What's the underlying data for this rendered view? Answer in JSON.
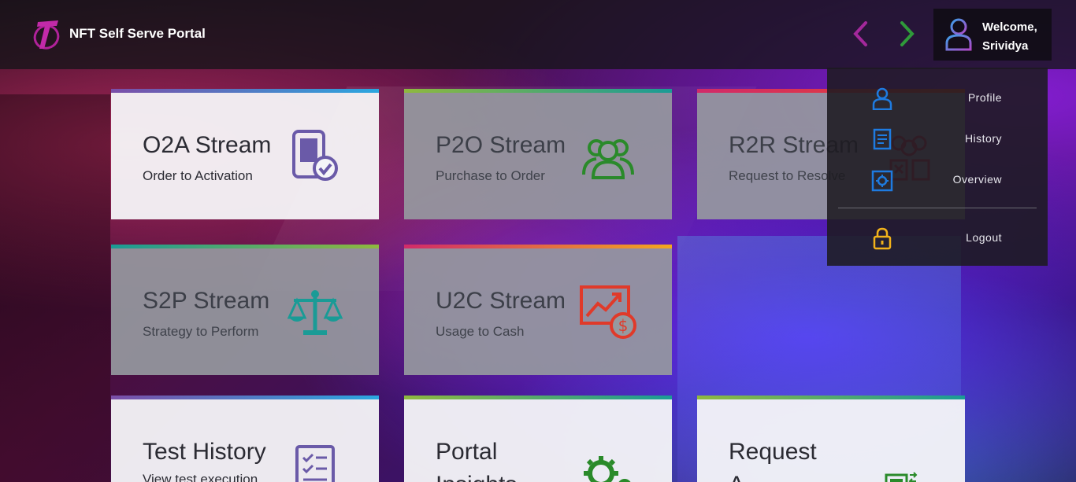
{
  "header": {
    "app_title": "NFT Self Serve Portal",
    "logo_icon": "telstra-t-logo-icon",
    "back_icon": "chevron-left-icon",
    "forward_icon": "chevron-right-icon",
    "welcome_line1": "Welcome,",
    "welcome_line2": "Srividya",
    "avatar_icon": "user-avatar-icon"
  },
  "colors": {
    "back_arrow": "#a3289b",
    "forward_arrow": "#2f9a3a",
    "menu_icon_blue": "#1e7be0",
    "menu_icon_lock": "#f2b21a"
  },
  "cards": [
    {
      "id": "o2a",
      "title": "O2A Stream",
      "subtitle": "Order to Activation",
      "icon": "mobile-check-icon",
      "icon_color": "#6a5aa8"
    },
    {
      "id": "p2o",
      "title": "P2O Stream",
      "subtitle": "Purchase to Order",
      "icon": "people-group-icon",
      "icon_color": "#2a8a2a"
    },
    {
      "id": "r2r",
      "title": "R2R Stream",
      "subtitle": "Request to Resolve",
      "icon": "people-cross-icon",
      "icon_color": "#b02a4a"
    },
    {
      "id": "s2p",
      "title": "S2P Stream",
      "subtitle": "Strategy to Perform",
      "icon": "balance-scale-icon",
      "icon_color": "#1a9b96"
    },
    {
      "id": "u2c",
      "title": "U2C Stream",
      "subtitle": "Usage to Cash",
      "icon": "growth-dollar-icon",
      "icon_color": "#e03a2a"
    },
    {
      "id": "th",
      "title": "Test History",
      "subtitle": "View test execution",
      "icon": "checklist-icon",
      "icon_color": "#6a5aa8"
    },
    {
      "id": "pi",
      "title": "Portal",
      "title2": "Insights",
      "icon": "gear-icon",
      "icon_color": "#2a8a2a"
    },
    {
      "id": "ra",
      "title": "Request",
      "title2": "A",
      "icon": "transfer-monitor-icon",
      "icon_color": "#2a8a2a"
    }
  ],
  "menu": {
    "items": [
      {
        "label": "Profile",
        "icon": "user-icon"
      },
      {
        "label": "History",
        "icon": "history-list-icon"
      },
      {
        "label": "Overview",
        "icon": "settings-box-icon"
      },
      {
        "label": "Logout",
        "icon": "lock-icon"
      }
    ]
  }
}
